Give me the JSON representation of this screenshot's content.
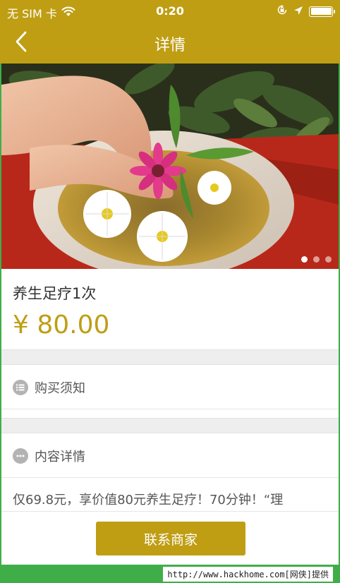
{
  "status_bar": {
    "carrier": "无 SIM 卡",
    "time": "0:20",
    "icons": [
      "wifi-icon",
      "orientation-lock-icon",
      "location-arrow-icon",
      "battery-icon"
    ],
    "battery_level": 1.0
  },
  "nav": {
    "title": "详情",
    "back_icon": "chevron-left-icon"
  },
  "banner": {
    "image": "foot-soak-basin-with-flowers",
    "slide_count": 3,
    "active_slide": 1
  },
  "product": {
    "name": "养生足疗1次",
    "price": "¥ 80.00"
  },
  "sections": {
    "purchase_notes": {
      "label": "购买须知",
      "icon": "list-icon"
    },
    "content_details": {
      "label": "内容详情",
      "icon": "more-dots-icon"
    }
  },
  "description": "仅69.8元，享价值80元养生足疗！70分钟！“理",
  "actions": {
    "contact_label": "联系商家"
  },
  "watermark": "http://www.hackhome.com[网侠]提供",
  "colors": {
    "brand_gold": "#bf9e14",
    "watermark_green": "#3fae49",
    "section_gap": "#eeeeee",
    "icon_gray": "#b3b3b3"
  }
}
